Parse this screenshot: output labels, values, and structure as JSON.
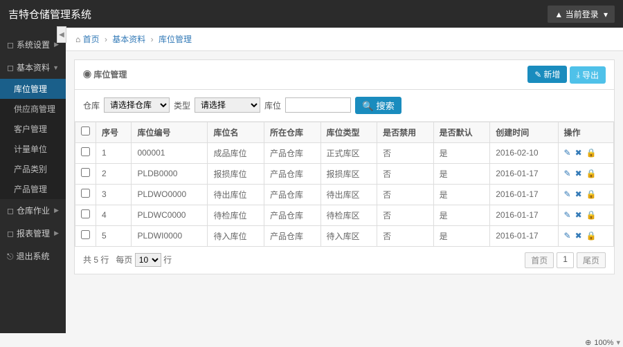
{
  "app_title": "吉特仓储管理系统",
  "login_label": "当前登录",
  "breadcrumb": {
    "home": "首页",
    "section": "基本资料",
    "page": "库位管理"
  },
  "sidebar": {
    "groups": [
      {
        "label": "系统设置",
        "key": "sys"
      },
      {
        "label": "基本资料",
        "key": "base",
        "items": [
          {
            "label": "库位管理",
            "active": true
          },
          {
            "label": "供应商管理"
          },
          {
            "label": "客户管理"
          },
          {
            "label": "计量单位"
          },
          {
            "label": "产品类别"
          },
          {
            "label": "产品管理"
          }
        ]
      },
      {
        "label": "仓库作业",
        "key": "wh"
      },
      {
        "label": "报表管理",
        "key": "rpt"
      },
      {
        "label": "退出系统",
        "key": "exit"
      }
    ]
  },
  "panel": {
    "title": "库位管理",
    "btn_new": "新增",
    "btn_export": "导出"
  },
  "filters": {
    "warehouse_label": "仓库",
    "warehouse_placeholder": "请选择仓库",
    "type_label": "类型",
    "type_placeholder": "请选择",
    "location_label": "库位",
    "search_label": "搜索"
  },
  "table": {
    "columns": [
      "序号",
      "库位编号",
      "库位名",
      "所在仓库",
      "库位类型",
      "是否禁用",
      "是否默认",
      "创建时间",
      "操作"
    ],
    "rows": [
      {
        "idx": "1",
        "code": "000001",
        "name": "成品库位",
        "wh": "产品仓库",
        "type": "正式库区",
        "disabled": "否",
        "default": "是",
        "created": "2016-02-10"
      },
      {
        "idx": "2",
        "code": "PLDB0000",
        "name": "报损库位",
        "wh": "产品仓库",
        "type": "报损库区",
        "disabled": "否",
        "default": "是",
        "created": "2016-01-17"
      },
      {
        "idx": "3",
        "code": "PLDWO0000",
        "name": "待出库位",
        "wh": "产品仓库",
        "type": "待出库区",
        "disabled": "否",
        "default": "是",
        "created": "2016-01-17"
      },
      {
        "idx": "4",
        "code": "PLDWC0000",
        "name": "待检库位",
        "wh": "产品仓库",
        "type": "待检库区",
        "disabled": "否",
        "default": "是",
        "created": "2016-01-17"
      },
      {
        "idx": "5",
        "code": "PLDWI0000",
        "name": "待入库位",
        "wh": "产品仓库",
        "type": "待入库区",
        "disabled": "否",
        "default": "是",
        "created": "2016-01-17"
      }
    ]
  },
  "pager": {
    "total_prefix": "共",
    "total_count": "5",
    "total_suffix": "行",
    "perpage_prefix": "每页",
    "perpage_value": "10",
    "perpage_suffix": "行",
    "first": "首页",
    "current": "1",
    "last": "尾页"
  },
  "zoom": "100%"
}
